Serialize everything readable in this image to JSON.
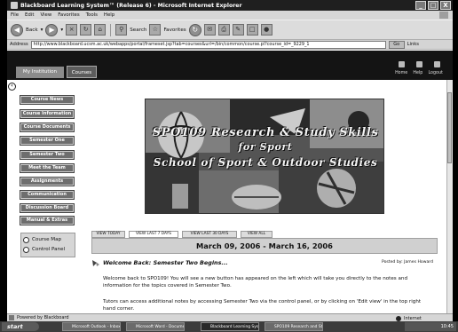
{
  "window": {
    "title": "Blackboard Learning System™ (Release 6) - Microsoft Internet Explorer",
    "controls": [
      "_",
      "□",
      "X"
    ]
  },
  "menu": [
    "File",
    "Edit",
    "View",
    "Favorites",
    "Tools",
    "Help"
  ],
  "toolbar": {
    "back_label": "Back",
    "search_label": "Search",
    "favorites_label": "Favorites"
  },
  "address": {
    "label": "Address",
    "url": "http://www.blackboard.ucsm.ac.uk/webapps/portal/frameset.jsp?tab=courses&url=/bin/common/course.pl?course_id=_9229_1",
    "go_label": "Go",
    "links_label": "Links"
  },
  "bb_header": {
    "tabs": [
      "My Institution",
      "Courses"
    ],
    "links": [
      "Home",
      "Help",
      "Logout"
    ]
  },
  "nav": {
    "items": [
      "Course News",
      "Course Information",
      "Course Documents",
      "Semester One",
      "Semester Two",
      "Meet the Team",
      "Assignments",
      "Communication",
      "Discussion Board",
      "Manual & Extras"
    ],
    "tools": [
      "Course Map",
      "Control Panel"
    ]
  },
  "banner": {
    "line1": "SPO109 Research & Study Skills",
    "line2": "for Sport",
    "line3": "School of Sport & Outdoor Studies"
  },
  "announcements": {
    "tabs": [
      "VIEW TODAY",
      "VIEW LAST 7 DAYS",
      "VIEW LAST 30 DAYS",
      "VIEW ALL"
    ],
    "date_range": "March 09, 2006 - March 16, 2006",
    "title": "Welcome Back: Semester Two Begins...",
    "posted_by": "Posted by: James Howard",
    "para1": "Welcome back to SPO109! You will see a new button has appeared on the left which will take you directly to the notes and information for the topics covered in Semester Two.",
    "para2": "Tutors can access additional notes by accessing Semester Two via the control panel, or by clicking on 'Edit view' in the top right hand corner."
  },
  "status": {
    "text": "Powered by Blackboard",
    "zone": "Internet"
  },
  "taskbar": {
    "start": "start",
    "tasks": [
      "Microsoft Outlook - Inbox",
      "Microsoft Word - Document1",
      "Blackboard Learning System",
      "SPO109 Research and Study"
    ],
    "clock": "10:45"
  },
  "colors": {
    "bb_header": "#141414",
    "nav_button": "#6e6e6e",
    "date_header": "#d0d0d0"
  }
}
